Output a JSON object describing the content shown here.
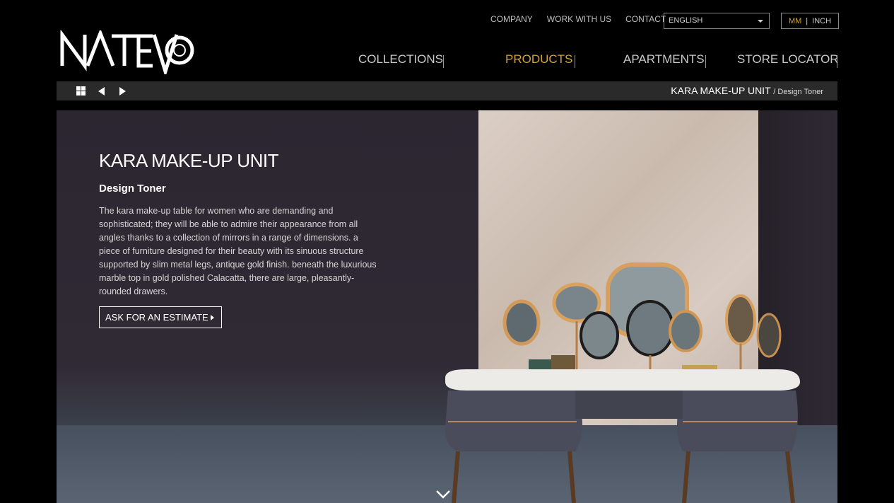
{
  "brand": {
    "logo_text": "NATEVO"
  },
  "top_nav": [
    {
      "label": "COMPANY"
    },
    {
      "label": "WORK WITH US"
    },
    {
      "label": "CONTACT"
    }
  ],
  "language": {
    "selected": "ENGLISH",
    "icon": "chevron-down-icon"
  },
  "units": {
    "mm": "MM",
    "separator": "|",
    "inch": "INCH",
    "active": "MM"
  },
  "main_nav": [
    {
      "label": "COLLECTIONS"
    },
    {
      "label": "PRODUCTS",
      "active": true
    },
    {
      "label": "APARTMENTS"
    },
    {
      "label": "STORE LOCATOR"
    }
  ],
  "toolbar": {
    "icons": [
      "grid-icon",
      "prev-arrow-icon",
      "next-arrow-icon"
    ],
    "breadcrumb_title": "KARA MAKE-UP UNIT",
    "breadcrumb_sub": "/ Design Toner"
  },
  "hero": {
    "title": "KARA MAKE-UP UNIT",
    "subtitle": "Design Toner",
    "description": "The kara make-up table for women who are demanding and sophisticated; they will be able to admire their appearance from all angles thanks to a collection of mirrors in a range of dimensions. a piece of furniture designed for their beauty with its sinuous structure supported by slim metal legs, antique gold finish. beneath the luxurious marble top in gold polished Calacatta, there are large, pleasantly-rounded drawers.",
    "cta_label": "ASK FOR AN ESTIMATE",
    "scroll_icon": "chevron-down-icon"
  },
  "colors": {
    "accent_gold": "#d2a43a",
    "background": "#000000",
    "toolbar": "#2a2a2a",
    "hero_dark": "#2c2631"
  }
}
